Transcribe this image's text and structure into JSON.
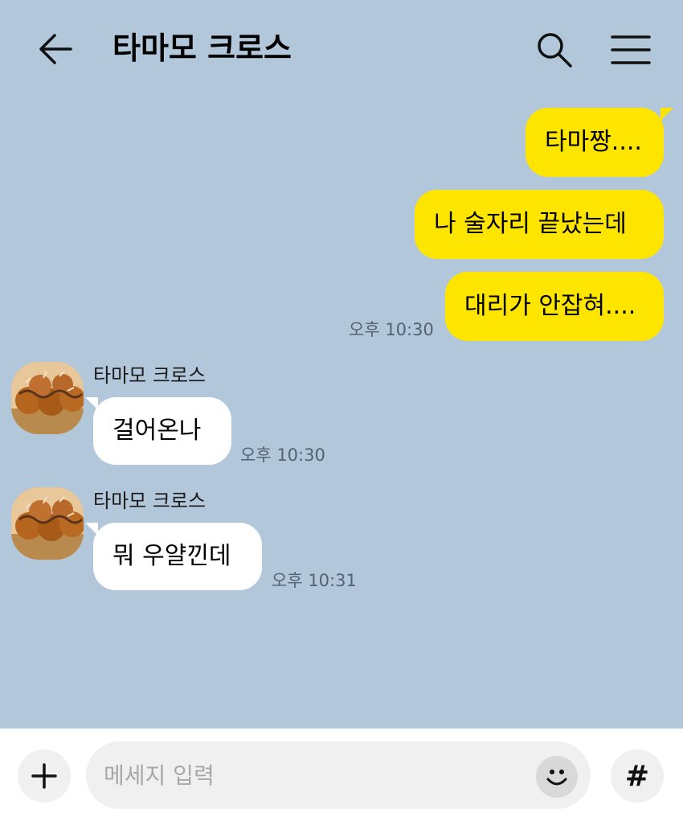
{
  "header": {
    "title": "타마모 크로스",
    "back_icon": "arrow-left-icon",
    "search_icon": "search-icon",
    "menu_icon": "menu-icon"
  },
  "colors": {
    "background": "#b2c7da",
    "my_bubble": "#fee500",
    "other_bubble": "#ffffff"
  },
  "messages": [
    {
      "from": "me",
      "text": "타마짱...."
    },
    {
      "from": "me",
      "text": "나 술자리 끝났는데"
    },
    {
      "from": "me",
      "text": "대리가 안잡혀....",
      "time": "오후 10:30"
    },
    {
      "from": "other",
      "sender": "타마모 크로스",
      "text": "걸어온나",
      "time": "오후 10:30"
    },
    {
      "from": "other",
      "sender": "타마모 크로스",
      "text": "뭐 우얄낀데",
      "time": "오후 10:31"
    }
  ],
  "composer": {
    "placeholder": "메세지 입력",
    "plus_icon": "plus-icon",
    "emoji_icon": "emoji-icon",
    "hash_label": "#"
  }
}
